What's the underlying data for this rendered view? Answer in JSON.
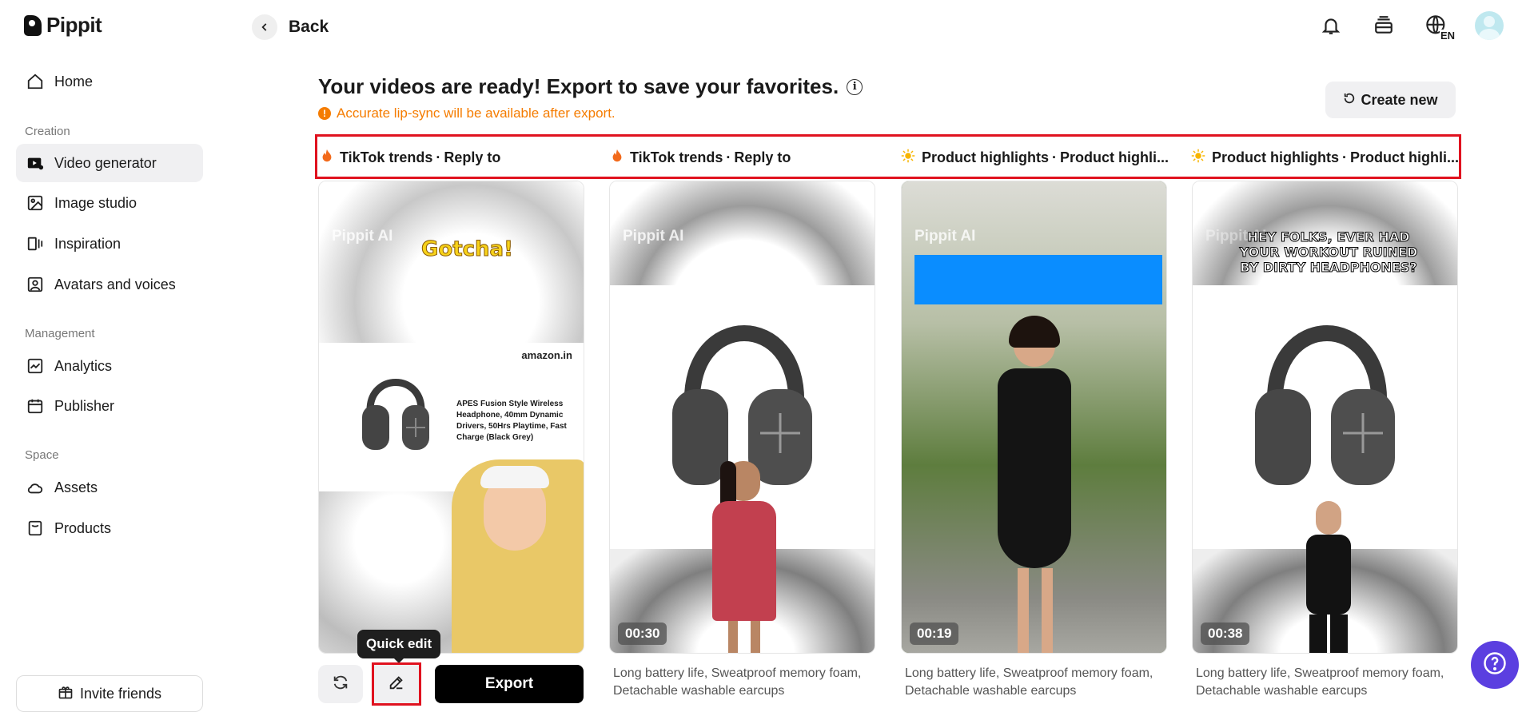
{
  "app": {
    "name": "Pippit"
  },
  "sidebar": {
    "home": "Home",
    "sections": {
      "creation": "Creation",
      "management": "Management",
      "space": "Space"
    },
    "items": {
      "video_generator": "Video generator",
      "image_studio": "Image studio",
      "inspiration": "Inspiration",
      "avatars": "Avatars and voices",
      "analytics": "Analytics",
      "publisher": "Publisher",
      "assets": "Assets",
      "products": "Products"
    },
    "invite": "Invite friends"
  },
  "header": {
    "back": "Back",
    "language": "EN"
  },
  "main": {
    "title": "Your videos are ready! Export to save your favorites.",
    "warning": "Accurate lip-sync will be available after export.",
    "create_new": "Create new",
    "tabs": [
      {
        "icon": "fire-icon",
        "category": "TikTok trends",
        "sep": "·",
        "style": "Reply to"
      },
      {
        "icon": "fire-icon",
        "category": "TikTok trends",
        "sep": "·",
        "style": "Reply to"
      },
      {
        "icon": "sun-icon",
        "category": "Product highlights",
        "sep": "·",
        "style": "Product highli..."
      },
      {
        "icon": "sun-icon",
        "category": "Product highlights",
        "sep": "·",
        "style": "Product highli..."
      }
    ],
    "cards": [
      {
        "watermark": "Pippit AI",
        "caption": "Gotcha!",
        "brand": "amazon.in",
        "product_text": "APES Fusion Style Wireless Headphone, 40mm Dynamic Drivers, 50Hrs Playtime, Fast Charge (Black Grey)"
      },
      {
        "watermark": "Pippit AI",
        "duration": "00:30",
        "desc": "Long battery life, Sweatproof memory foam, Detachable washable earcups"
      },
      {
        "watermark": "Pippit AI",
        "duration": "00:19",
        "desc": "Long battery life, Sweatproof memory foam, Detachable washable earcups"
      },
      {
        "watermark": "Pippit AI",
        "caption": "HEY FOLKS, EVER HAD YOUR WORKOUT RUINED BY DIRTY HEADPHONES?",
        "duration": "00:38",
        "desc": "Long battery life, Sweatproof memory foam, Detachable washable earcups"
      }
    ],
    "actions": {
      "tooltip": "Quick edit",
      "export": "Export"
    }
  },
  "colors": {
    "highlight": "#e0121f",
    "warning": "#f57c00",
    "help": "#5b3fe0"
  }
}
